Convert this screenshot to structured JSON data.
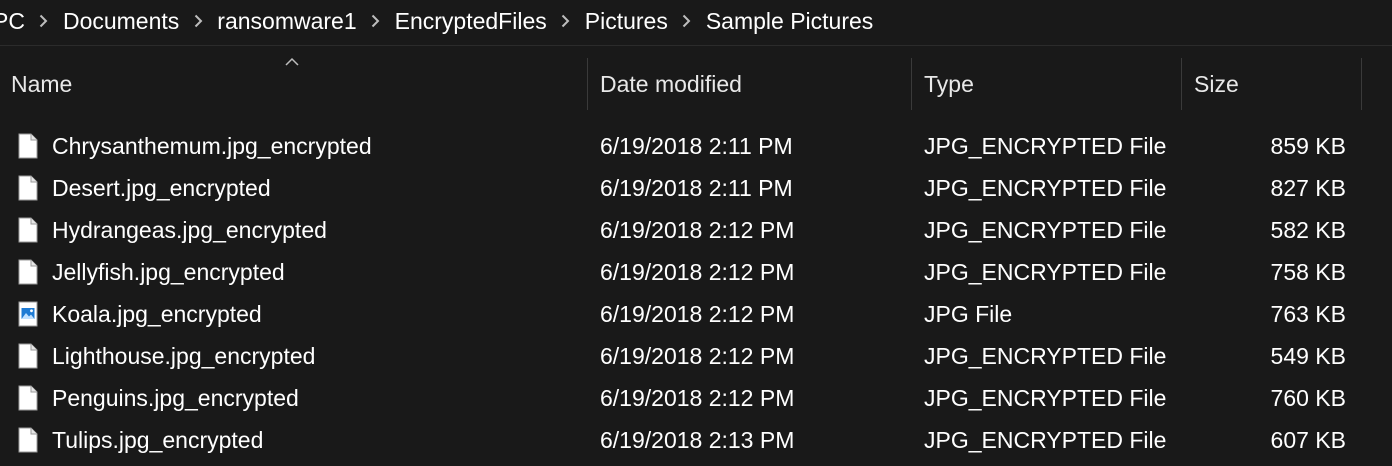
{
  "breadcrumb": {
    "items": [
      {
        "label": "PC"
      },
      {
        "label": "Documents"
      },
      {
        "label": "ransomware1"
      },
      {
        "label": "EncryptedFiles"
      },
      {
        "label": "Pictures"
      },
      {
        "label": "Sample Pictures"
      }
    ],
    "separator_icon": "chevron-right-icon"
  },
  "columns": {
    "name": "Name",
    "date_modified": "Date modified",
    "type": "Type",
    "size": "Size",
    "sort_icon": "sort-ascending-icon"
  },
  "files": [
    {
      "name": "Chrysanthemum.jpg_encrypted",
      "date": "6/19/2018 2:11 PM",
      "type": "JPG_ENCRYPTED File",
      "size": "859 KB",
      "icon": "blank-file-icon"
    },
    {
      "name": "Desert.jpg_encrypted",
      "date": "6/19/2018 2:11 PM",
      "type": "JPG_ENCRYPTED File",
      "size": "827 KB",
      "icon": "blank-file-icon"
    },
    {
      "name": "Hydrangeas.jpg_encrypted",
      "date": "6/19/2018 2:12 PM",
      "type": "JPG_ENCRYPTED File",
      "size": "582 KB",
      "icon": "blank-file-icon"
    },
    {
      "name": "Jellyfish.jpg_encrypted",
      "date": "6/19/2018 2:12 PM",
      "type": "JPG_ENCRYPTED File",
      "size": "758 KB",
      "icon": "blank-file-icon"
    },
    {
      "name": "Koala.jpg_encrypted",
      "date": "6/19/2018 2:12 PM",
      "type": "JPG File",
      "size": "763 KB",
      "icon": "image-file-icon"
    },
    {
      "name": "Lighthouse.jpg_encrypted",
      "date": "6/19/2018 2:12 PM",
      "type": "JPG_ENCRYPTED File",
      "size": "549 KB",
      "icon": "blank-file-icon"
    },
    {
      "name": "Penguins.jpg_encrypted",
      "date": "6/19/2018 2:12 PM",
      "type": "JPG_ENCRYPTED File",
      "size": "760 KB",
      "icon": "blank-file-icon"
    },
    {
      "name": "Tulips.jpg_encrypted",
      "date": "6/19/2018 2:13 PM",
      "type": "JPG_ENCRYPTED File",
      "size": "607 KB",
      "icon": "blank-file-icon"
    }
  ],
  "colors": {
    "background": "#191919",
    "text": "#ffffff",
    "divider": "#3a3a3a",
    "image_icon_blue": "#1e7bd4"
  }
}
